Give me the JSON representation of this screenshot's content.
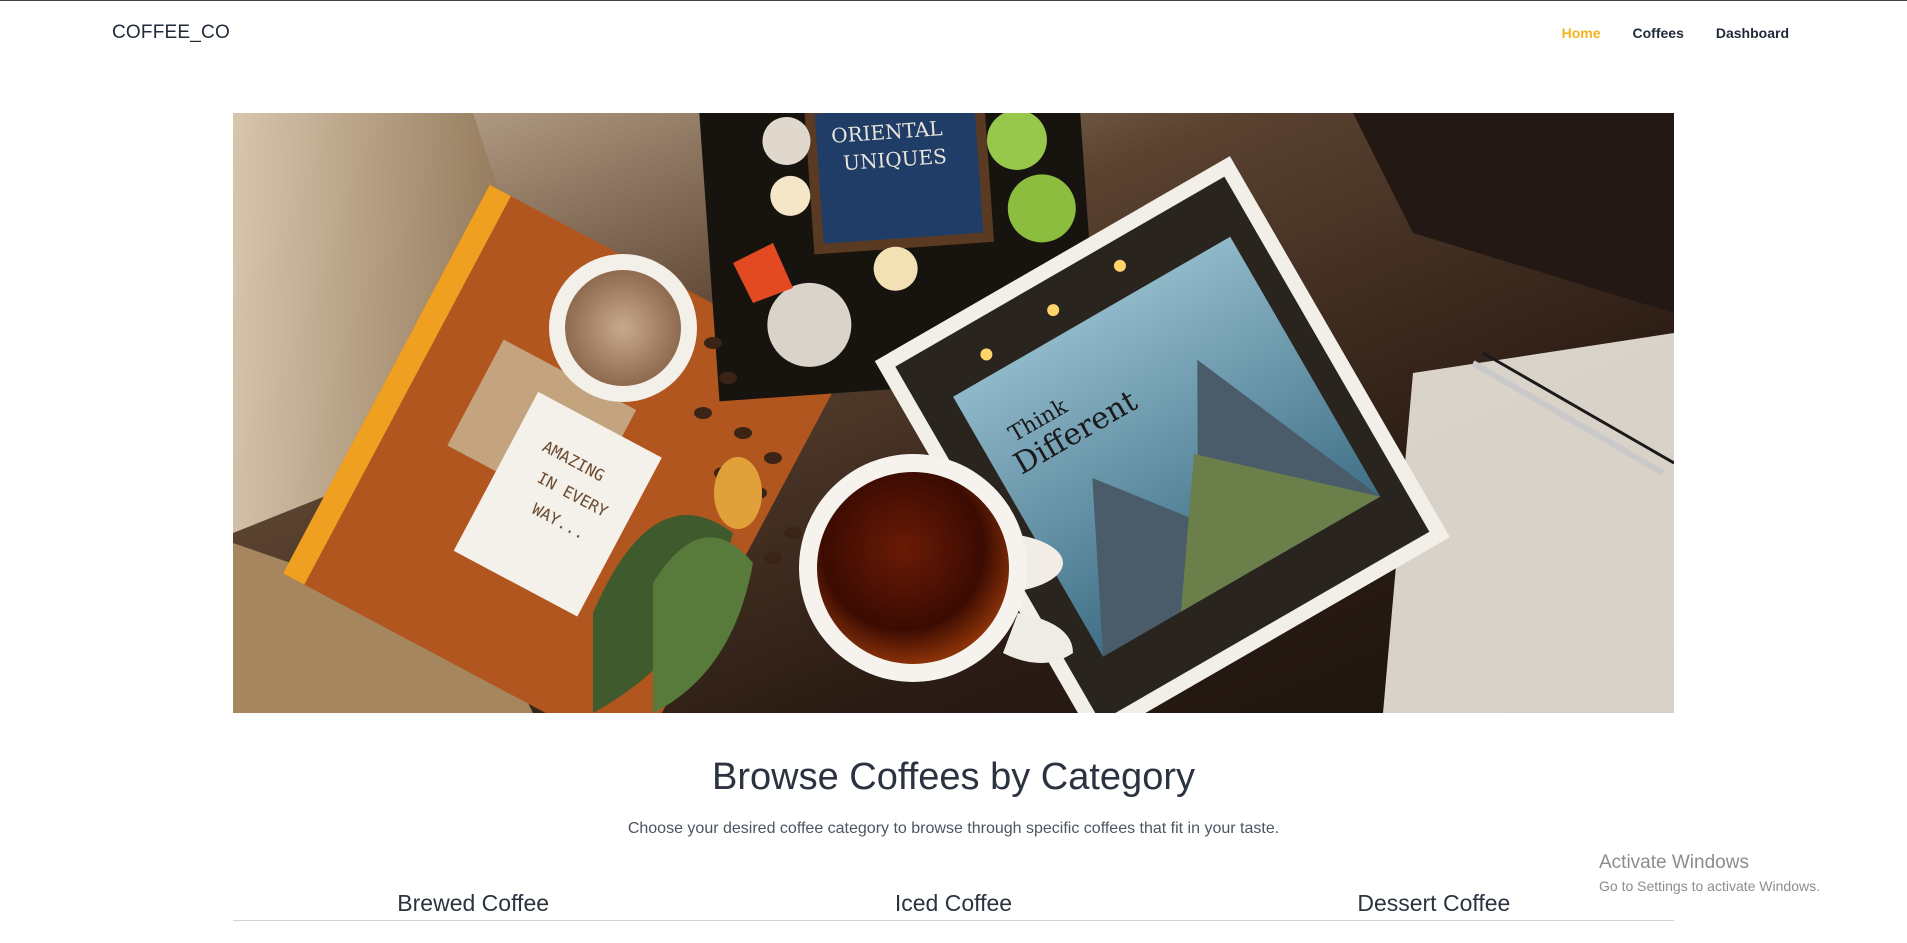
{
  "brand": "COFFEE_CO",
  "nav": [
    {
      "label": "Home",
      "active": true
    },
    {
      "label": "Coffees",
      "active": false
    },
    {
      "label": "Dashboard",
      "active": false
    }
  ],
  "hero": {
    "image": "coffee-flatlay-photo",
    "image_text": {
      "card_left": "AMAZING IN EVERY WAY...",
      "book_top": "ORIENTAL UNIQUES",
      "book_right_1": "Think",
      "book_right_2": "Different"
    }
  },
  "section": {
    "title": "Browse Coffees by Category",
    "subtitle": "Choose your desired coffee category to browse through specific coffees that fit in your taste."
  },
  "categories": [
    "Brewed Coffee",
    "Iced Coffee",
    "Dessert Coffee"
  ],
  "watermark": {
    "line1": "Activate Windows",
    "line2": "Go to Settings to activate Windows."
  },
  "colors": {
    "accent": "#f3b321",
    "text": "#1f2937"
  }
}
